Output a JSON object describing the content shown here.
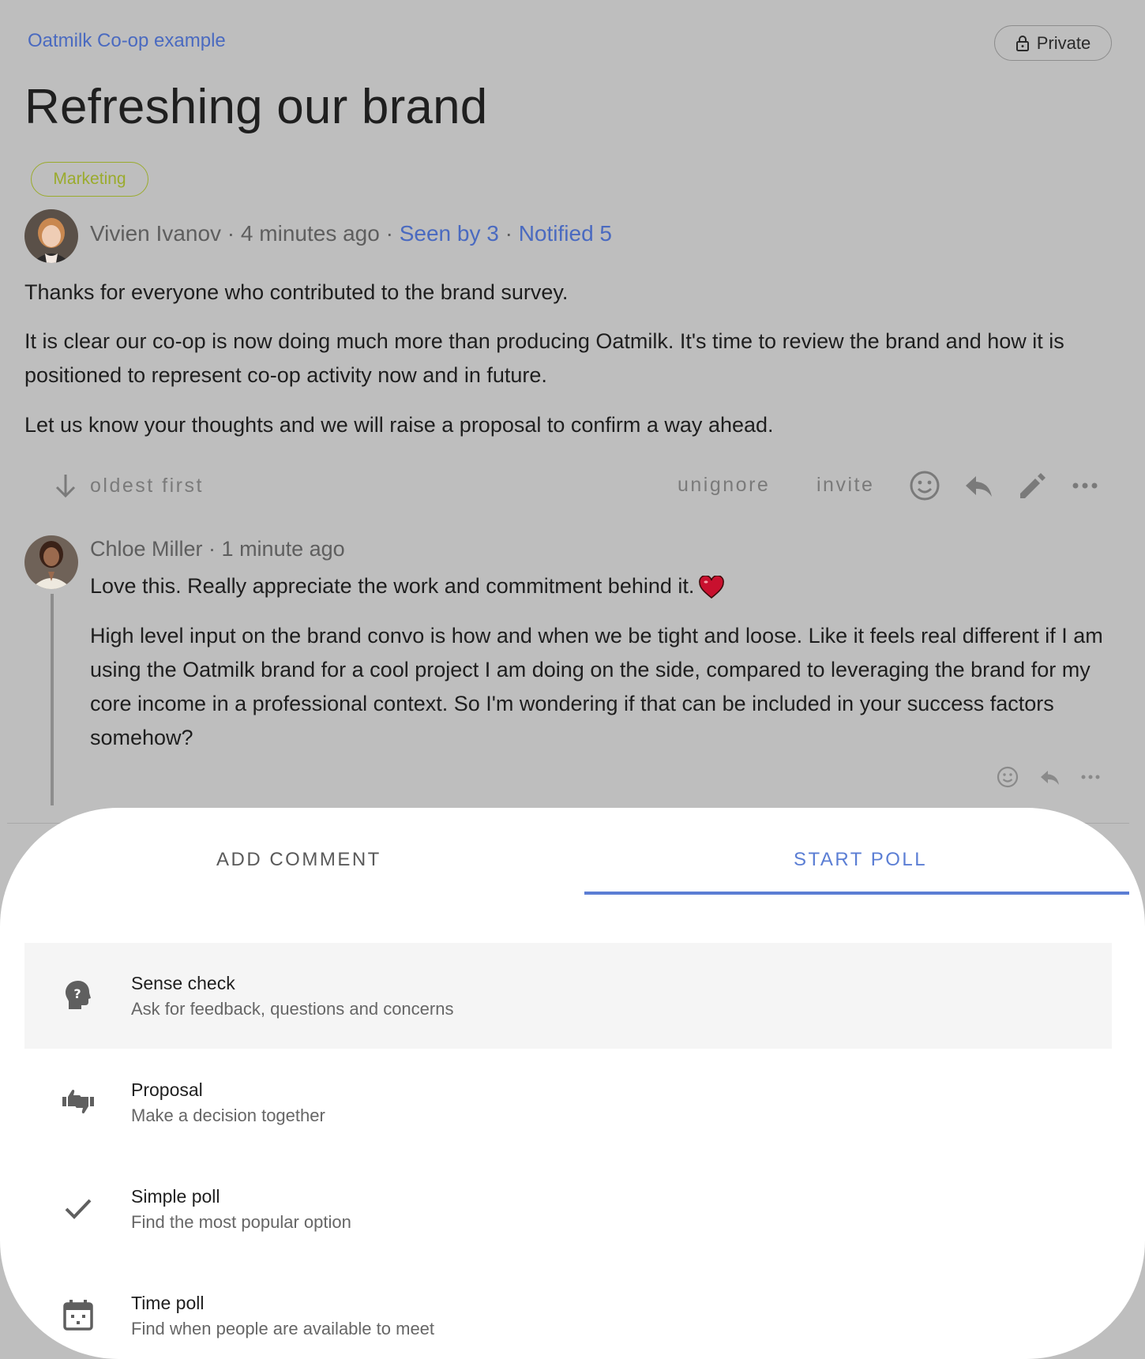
{
  "header": {
    "group_link": "Oatmilk Co-op example",
    "privacy_label": "Private"
  },
  "thread": {
    "title": "Refreshing our brand",
    "tag": "Marketing",
    "author": "Vivien Ivanov",
    "time": "4 minutes ago",
    "seen_by": "Seen by 3",
    "notified": "Notified 5",
    "separator": " · ",
    "paragraphs": [
      "Thanks for everyone who contributed to the brand survey.",
      "It is clear our co-op is now doing much more than producing Oatmilk. It's time to review the brand and how it is positioned to represent co-op activity now and in future.",
      "Let us know your thoughts and we will raise a proposal to confirm a way ahead."
    ]
  },
  "actions": {
    "sort_label": "oldest first",
    "unignore_label": "unignore",
    "invite_label": "invite",
    "icons": [
      "emoji-icon",
      "reply-icon",
      "edit-icon",
      "more-icon"
    ]
  },
  "comment": {
    "author": "Chloe Miller",
    "time": "1 minute ago",
    "paragraphs": [
      "Love this. Really appreciate the work and commitment behind it.",
      "High level input on the brand convo is how and when we be tight and loose. Like it feels real different if I am using the Oatmilk brand for a cool project I am doing on the side, compared to leveraging the brand for my core income in a professional context. So I'm wondering if that can be included in your success factors somehow?"
    ],
    "icons": [
      "emoji-icon",
      "reply-icon",
      "more-icon"
    ]
  },
  "composer": {
    "tabs": [
      {
        "label": "ADD COMMENT",
        "active": false
      },
      {
        "label": "START POLL",
        "active": true
      }
    ],
    "poll_types": [
      {
        "title": "Sense check",
        "subtitle": "Ask for feedback, questions and concerns",
        "icon": "head-question-icon",
        "selected": true
      },
      {
        "title": "Proposal",
        "subtitle": "Make a decision together",
        "icon": "thumbs-icon",
        "selected": false
      },
      {
        "title": "Simple poll",
        "subtitle": "Find the most popular option",
        "icon": "check-icon",
        "selected": false
      },
      {
        "title": "Time poll",
        "subtitle": "Find when people are available to meet",
        "icon": "calendar-icon",
        "selected": false
      }
    ]
  },
  "colors": {
    "backdrop": "#bebebe",
    "link": "#4a6ac0",
    "tag": "#9aab2c",
    "accent": "#5b7ed4"
  }
}
